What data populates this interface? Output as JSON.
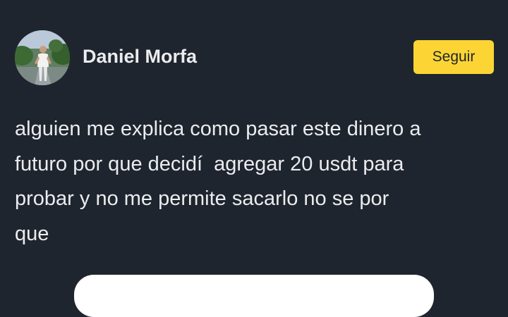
{
  "post": {
    "author": {
      "name": "Daniel Morfa",
      "avatar_icon": "user-photo-avatar"
    },
    "follow_label": "Seguir",
    "text": "alguien me explica como pasar este dinero a\nfuturo por que decidí  agregar 20 usdt para\nprobar y no me permite sacarlo no se por\nque"
  },
  "colors": {
    "background": "#1f252e",
    "accent": "#fcd535",
    "text": "#eaecef"
  }
}
